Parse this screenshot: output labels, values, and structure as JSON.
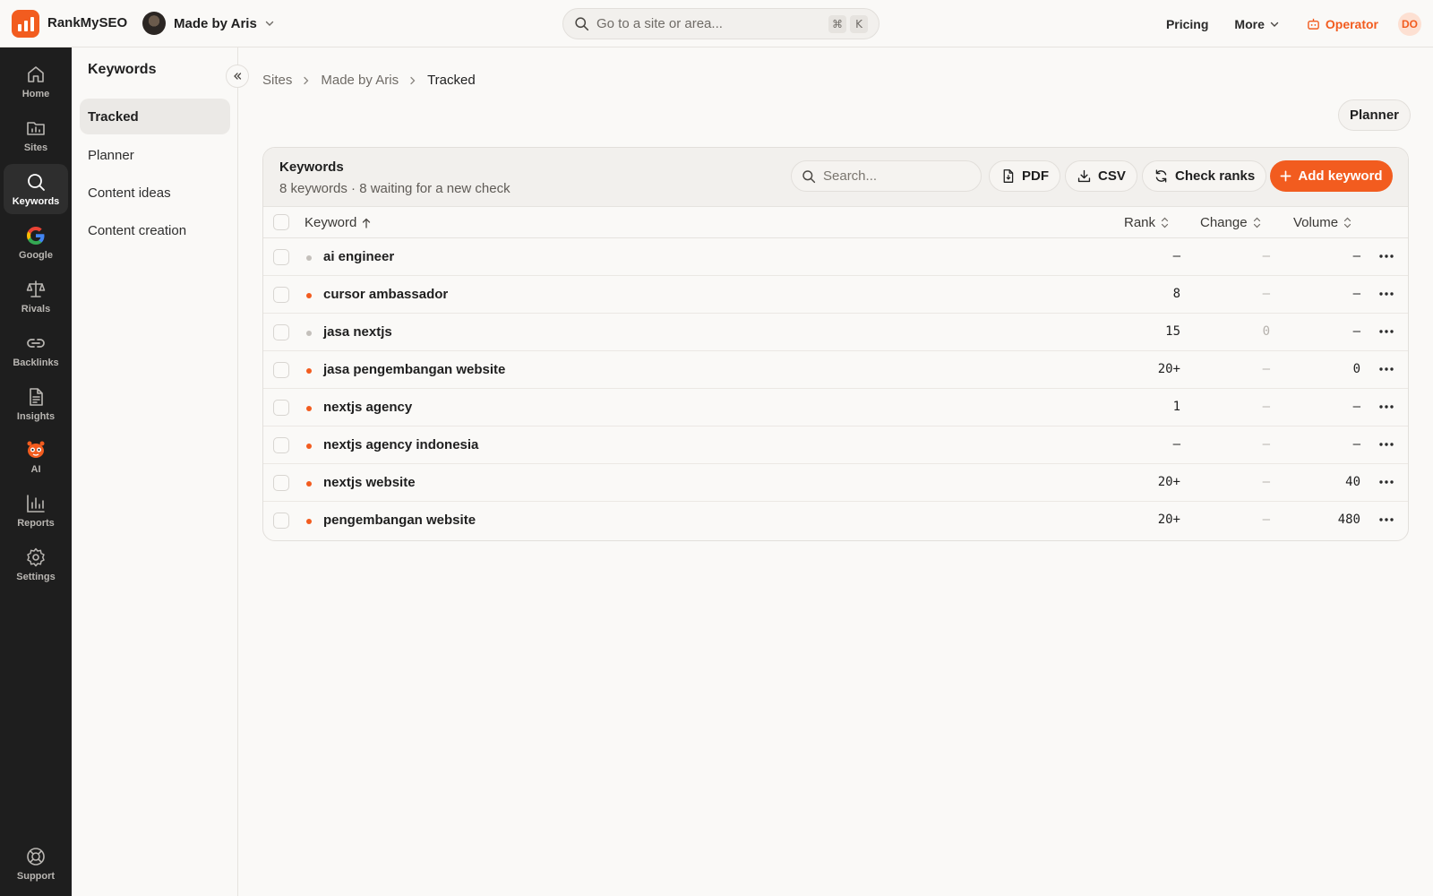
{
  "topbar": {
    "brand": "RankMySEO",
    "site_name": "Made by Aris",
    "search_placeholder": "Go to a site or area...",
    "shortcut_keys": [
      "⌘",
      "K"
    ],
    "pricing": "Pricing",
    "more": "More",
    "operator": "Operator",
    "user_initials": "DO"
  },
  "rail": {
    "items": [
      {
        "label": "Home",
        "icon": "home-icon"
      },
      {
        "label": "Sites",
        "icon": "sites-icon"
      },
      {
        "label": "Keywords",
        "icon": "search-icon",
        "active": true
      },
      {
        "label": "Google",
        "icon": "google-icon"
      },
      {
        "label": "Rivals",
        "icon": "scale-icon"
      },
      {
        "label": "Backlinks",
        "icon": "link-icon"
      },
      {
        "label": "Insights",
        "icon": "document-icon"
      },
      {
        "label": "AI",
        "icon": "robot-icon"
      },
      {
        "label": "Reports",
        "icon": "bar-chart-icon"
      },
      {
        "label": "Settings",
        "icon": "gear-icon"
      }
    ],
    "support": "Support"
  },
  "subnav": {
    "title": "Keywords",
    "items": [
      {
        "label": "Tracked",
        "active": true
      },
      {
        "label": "Planner"
      },
      {
        "label": "Content ideas"
      },
      {
        "label": "Content creation"
      }
    ]
  },
  "breadcrumb": [
    "Sites",
    "Made by Aris",
    "Tracked"
  ],
  "planner_button": "Planner",
  "card": {
    "title": "Keywords",
    "subtitle": "8 keywords · 8 waiting for a new check",
    "search_placeholder": "Search...",
    "pdf": "PDF",
    "csv": "CSV",
    "check_ranks": "Check ranks",
    "add_keyword": "Add keyword"
  },
  "table": {
    "headers": {
      "keyword": "Keyword",
      "rank": "Rank",
      "change": "Change",
      "volume": "Volume"
    },
    "rows": [
      {
        "keyword": "ai engineer",
        "rank": "–",
        "change": "–",
        "volume": "–",
        "dot": "#c4c0bb"
      },
      {
        "keyword": "cursor ambassador",
        "rank": "8",
        "change": "–",
        "volume": "–",
        "dot": "#f25c1f"
      },
      {
        "keyword": "jasa nextjs",
        "rank": "15",
        "change": "0",
        "volume": "–",
        "dot": "#c4c0bb"
      },
      {
        "keyword": "jasa pengembangan website",
        "rank": "20+",
        "change": "–",
        "volume": "0",
        "dot": "#f25c1f"
      },
      {
        "keyword": "nextjs agency",
        "rank": "1",
        "change": "–",
        "volume": "–",
        "dot": "#f25c1f"
      },
      {
        "keyword": "nextjs agency indonesia",
        "rank": "–",
        "change": "–",
        "volume": "–",
        "dot": "#f25c1f"
      },
      {
        "keyword": "nextjs website",
        "rank": "20+",
        "change": "–",
        "volume": "40",
        "dot": "#f25c1f"
      },
      {
        "keyword": "pengembangan website",
        "rank": "20+",
        "change": "–",
        "volume": "480",
        "dot": "#f25c1f"
      }
    ]
  },
  "colors": {
    "accent": "#f25c1f",
    "rail_bg": "#1e1e1e",
    "page_bg": "#faf9f7"
  }
}
